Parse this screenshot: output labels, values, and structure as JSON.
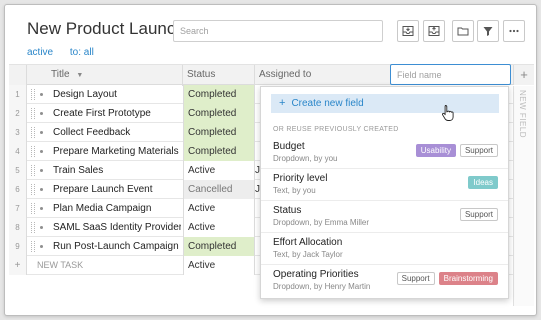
{
  "header": {
    "title": "New Product Launch",
    "filters": [
      "active",
      "to: all"
    ],
    "search_placeholder": "Search"
  },
  "toolbar": {
    "icons": [
      "inbox-down-icon",
      "inbox-up-icon",
      "folder-icon",
      "filter-icon",
      "more-icon"
    ]
  },
  "table": {
    "columns": [
      "Title",
      "Status",
      "Assigned to"
    ],
    "rows": [
      {
        "num": "1",
        "title": "Design Layout",
        "status": "Completed",
        "assigned": ""
      },
      {
        "num": "2",
        "title": "Create First Prototype",
        "status": "Completed",
        "assigned": ""
      },
      {
        "num": "3",
        "title": "Collect Feedback",
        "status": "Completed",
        "assigned": ""
      },
      {
        "num": "4",
        "title": "Prepare Marketing Materials",
        "status": "Completed",
        "assigned": ""
      },
      {
        "num": "5",
        "title": "Train Sales",
        "status": "Active",
        "assigned": "J"
      },
      {
        "num": "6",
        "title": "Prepare Launch Event",
        "status": "Cancelled",
        "assigned": "J"
      },
      {
        "num": "7",
        "title": "Plan Media Campaign",
        "status": "Active",
        "assigned": ""
      },
      {
        "num": "8",
        "title": "SAML SaaS Identity Providers",
        "status": "Active",
        "assigned": ""
      },
      {
        "num": "9",
        "title": "Run Post-Launch Campaign",
        "status": "Completed",
        "assigned": ""
      }
    ],
    "new_row": {
      "symbol": "+",
      "label": "NEW TASK",
      "status": "Active"
    }
  },
  "new_field": {
    "input_placeholder": "Field name",
    "plus": "+",
    "column_label": "NEW FIELD",
    "create_label": "Create new field",
    "create_symbol": "+",
    "reuse_heading": "OR REUSE PREVIOUSLY CREATED",
    "fields": [
      {
        "name": "Budget",
        "sub": "Dropdown, by you",
        "tags": [
          {
            "label": "Usability",
            "kind": "usability"
          },
          {
            "label": "Support",
            "kind": "plain"
          }
        ]
      },
      {
        "name": "Priority level",
        "sub": "Text, by you",
        "tags": [
          {
            "label": "Ideas",
            "kind": "ideas"
          }
        ]
      },
      {
        "name": "Status",
        "sub": "Dropdown, by Emma Miller",
        "tags": [
          {
            "label": "Support",
            "kind": "plain"
          }
        ]
      },
      {
        "name": "Effort Allocation",
        "sub": "Text, by Jack Taylor",
        "tags": []
      },
      {
        "name": "Operating Priorities",
        "sub": "Dropdown, by Henry Martin",
        "tags": [
          {
            "label": "Support",
            "kind": "plain"
          },
          {
            "label": "Brainstorming",
            "kind": "brainstorming"
          }
        ]
      }
    ]
  },
  "colors": {
    "accent": "#2a86c9",
    "completed_bg": "#dfeeca",
    "cancelled_bg": "#ededed",
    "usability": "#a88fd6",
    "ideas": "#7fcacb",
    "brainstorming": "#dc8289"
  }
}
